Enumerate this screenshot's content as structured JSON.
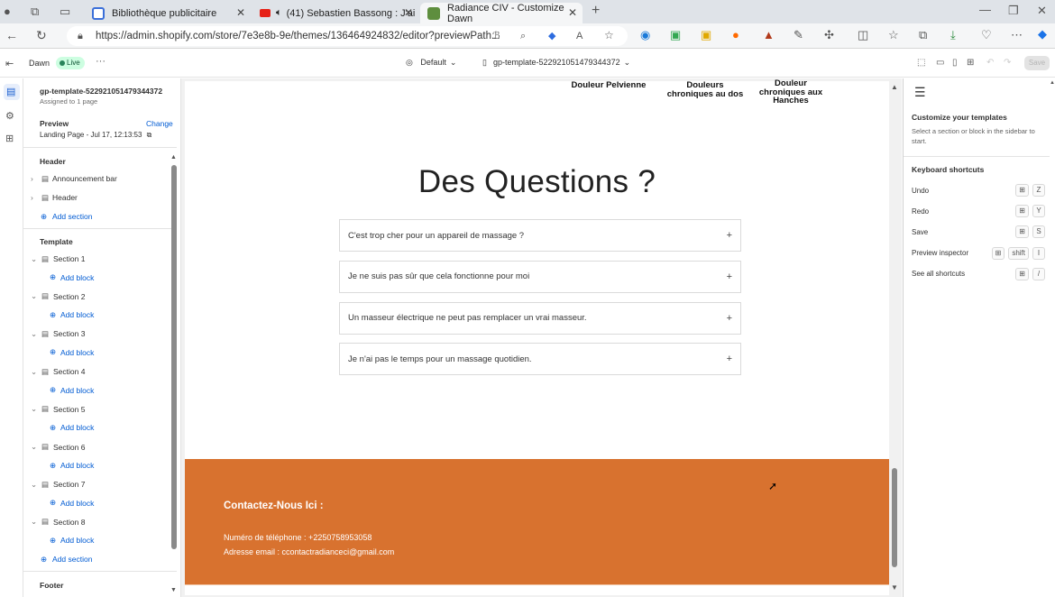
{
  "browser": {
    "tabs": [
      {
        "title": "Bibliothèque publicitaire",
        "active": false
      },
      {
        "title": "(41) Sebastien Bassong : J'ai",
        "active": false
      },
      {
        "title": "Radiance CIV - Customize Dawn",
        "active": true
      }
    ],
    "url": "https://admin.shopify.com/store/7e3e8b-9e/themes/136464924832/editor?previewPath..."
  },
  "editor_header": {
    "theme_name": "Dawn",
    "live_badge": "Live",
    "more": "···",
    "preset": "Default",
    "template": "gp-template-522921051479344372",
    "save_label": "Save"
  },
  "sidebar": {
    "template_name": "gp-template-522921051479344372",
    "assigned": "Assigned to 1 page",
    "preview_label": "Preview",
    "change_label": "Change",
    "preview_page": "Landing Page - Jul 17, 12:13:53",
    "header_group": "Header",
    "header_items": [
      "Announcement bar",
      "Header"
    ],
    "add_section": "Add section",
    "template_group": "Template",
    "sections": [
      "Section 1",
      "Section 2",
      "Section 3",
      "Section 4",
      "Section 5",
      "Section 6",
      "Section 7",
      "Section 8"
    ],
    "add_block": "Add block",
    "footer_group": "Footer"
  },
  "preview": {
    "top_labels": [
      "Douleur Pelvienne",
      "Douleurs chroniques au dos",
      "Douleur chroniques aux Hanches"
    ],
    "faq_title": "Des Questions ?",
    "faq_items": [
      "C'est trop cher pour un appareil de massage ?",
      "Je ne suis pas sûr que cela fonctionne pour moi",
      "Un masseur électrique ne peut pas remplacer un vrai masseur.",
      "Je n'ai pas le temps pour un massage quotidien."
    ],
    "contact_title": "Contactez-Nous Ici :",
    "phone": "Numéro de téléphone : +2250758953058",
    "email": "Adresse email : ccontactradianceci@gmail.com",
    "footer_color": "#d8722f"
  },
  "right_panel": {
    "title": "Customize your templates",
    "subtitle": "Select a section or block in the sidebar to start.",
    "shortcuts_title": "Keyboard shortcuts",
    "shortcuts": [
      {
        "label": "Undo",
        "keys": [
          "⊞",
          "Z"
        ]
      },
      {
        "label": "Redo",
        "keys": [
          "⊞",
          "Y"
        ]
      },
      {
        "label": "Save",
        "keys": [
          "⊞",
          "S"
        ]
      },
      {
        "label": "Preview inspector",
        "keys": [
          "⊞",
          "shift",
          "I"
        ]
      },
      {
        "label": "See all shortcuts",
        "keys": [
          "⊞",
          "/"
        ]
      }
    ]
  }
}
